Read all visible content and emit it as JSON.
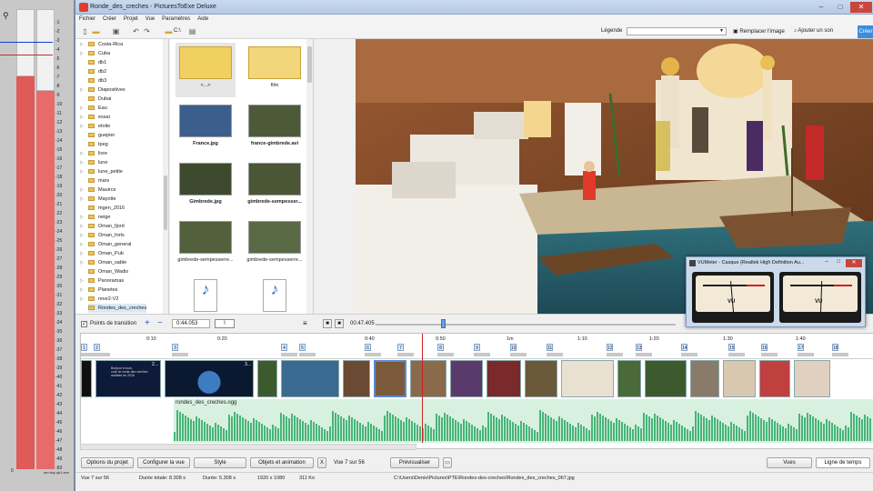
{
  "meters": {
    "ticks": [
      "-1",
      "-2",
      "-3",
      "-4",
      "-5",
      "-6",
      "-7",
      "-8",
      "-9",
      "-10",
      "-11",
      "-12",
      "-13",
      "-14",
      "-15",
      "-16",
      "-17",
      "-18",
      "-19",
      "-20",
      "-21",
      "-22",
      "-23",
      "-24",
      "-25",
      "-26",
      "-27",
      "-28",
      "-29",
      "-30",
      "-31",
      "-32",
      "-33",
      "-34",
      "-35",
      "-36",
      "-37",
      "-38",
      "-39",
      "-40",
      "-41",
      "-42",
      "-43",
      "-44",
      "-45",
      "-46",
      "-47",
      "-48",
      "-49",
      "-50"
    ],
    "bottom_left": "0",
    "bottom_right": "exe.Ldp-pot.ros"
  },
  "window": {
    "title": "Ronde_des_creches - PicturesToExe Deluxe",
    "min": "–",
    "max": "□",
    "close": "✕"
  },
  "menu": [
    "Fichier",
    "Créer",
    "Projet",
    "Vue",
    "Paramètres",
    "Aide"
  ],
  "toolbar": {
    "path_label": "C:\\",
    "legende_label": "Légende",
    "legende_value": "",
    "replace_image": "Remplacer l'image",
    "add_sound": "Ajouter un son",
    "create": "Créer"
  },
  "tree": [
    "Costa-Rica",
    "Cuba",
    "db1",
    "db2",
    "db3",
    "Diapositives",
    "Dubai",
    "Eau",
    "essai",
    "etoile",
    "guepier",
    "Ipeg",
    "livre",
    "lune",
    "lune_petite",
    "mars",
    "Mauirce",
    "Mayotte",
    "mgen_2016",
    "neige",
    "Oman_fjord",
    "Oman_forts",
    "Oman_general",
    "Oman_Pub",
    "Oman_sable",
    "Oman_Wadis",
    "Panoramas",
    "Planetes",
    "reve2-V2",
    "Rondes_des_creches"
  ],
  "thumbs": [
    {
      "label": "<...>",
      "bold": false
    },
    {
      "label": "film",
      "bold": false
    },
    {
      "label": "France.jpg",
      "bold": true
    },
    {
      "label": "france-gimbrede.avi",
      "bold": true
    },
    {
      "label": "Gimbrede.jpg",
      "bold": true
    },
    {
      "label": "gimbrede-sempesser...",
      "bold": true
    },
    {
      "label": "gimbrede-sempesserre...",
      "bold": false
    },
    {
      "label": "gimbrede-sempesserre...",
      "bold": false
    },
    {
      "label": "",
      "bold": false
    },
    {
      "label": "",
      "bold": false
    }
  ],
  "controls": {
    "transition_points": "Points de transition",
    "time1": "0:44.053",
    "time2": "00:47.405"
  },
  "ruler": {
    "times": [
      "0:10",
      "0:20",
      "0:40",
      "0:50",
      "1m",
      "1:10",
      "1:20",
      "1:30",
      "1:40"
    ],
    "slides": [
      "1",
      "2",
      "3",
      "4",
      "5",
      "6",
      "7",
      "8",
      "9",
      "10",
      "11",
      "12",
      "13",
      "14",
      "15",
      "16",
      "17",
      "18"
    ]
  },
  "timeline": {
    "audio_file": "rondes_des_creches.ogg",
    "slide1_text": "Bonjour à tous,\nvoici la ronde des crèches\nréalisée en 2016",
    "slide2_num": "2...",
    "slide3_num": "3..."
  },
  "buttons": {
    "project_options": "Options du projet",
    "configure_view": "Configurer la vue",
    "style": "Style",
    "objects_animation": "Objets et animation",
    "x": "X",
    "view_count": "Vue 7 sur 56",
    "preview": "Prévisualiser",
    "tab_views": "Vues",
    "tab_timeline": "Ligne de temps"
  },
  "status": {
    "view": "Vue 7 sur 56",
    "total": "Durée totale: 8.308 s",
    "duration": "Durée: 5.308 s",
    "resolution": "1920 x 1080",
    "size": "311 Ko",
    "path": "C:\\Users\\Denis\\Pictures\\PTE\\Rondes-des-creches\\Rondes_des_creches_067.jpg"
  },
  "vu": {
    "title": "VUMeter - Casque (Realtek High Definition Au...",
    "left_label": "VU",
    "right_label": "VU"
  }
}
